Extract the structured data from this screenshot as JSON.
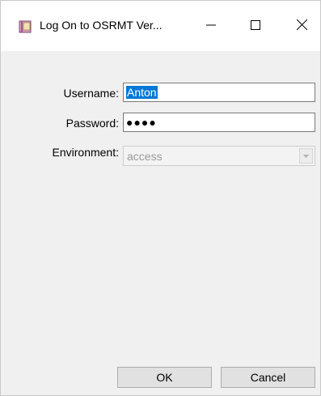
{
  "window": {
    "title": "Log On to OSRMT Ver..."
  },
  "form": {
    "username_label": "Username:",
    "username_value": "Anton",
    "password_label": "Password:",
    "password_value": "●●●●",
    "environment_label": "Environment:",
    "environment_value": "access"
  },
  "buttons": {
    "ok_label": "OK",
    "cancel_label": "Cancel"
  },
  "icons": {
    "app": "book-icon",
    "minimize": "minimize-icon",
    "maximize": "maximize-icon",
    "close": "close-icon",
    "dropdown": "chevron-down-icon"
  },
  "colors": {
    "selection": "#0078d7",
    "client_bg": "#f0f0f0",
    "titlebar_bg": "#ffffff",
    "disabled_text": "#9a9a9a"
  }
}
